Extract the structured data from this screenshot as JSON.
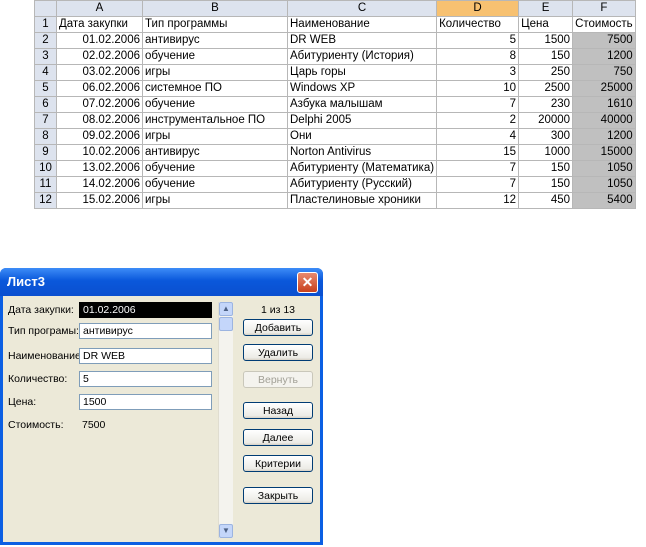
{
  "sheet": {
    "columns": [
      "A",
      "B",
      "C",
      "D",
      "E",
      "F"
    ],
    "rows": [
      {
        "n": "1",
        "a": "Дата закупки",
        "b": "Тип программы",
        "c": "Наименование",
        "d": "Количество",
        "e": "Цена",
        "f": "Стоимость"
      },
      {
        "n": "2",
        "a": "01.02.2006",
        "b": "антивирус",
        "c": "DR WEB",
        "d": "5",
        "e": "1500",
        "f": "7500"
      },
      {
        "n": "3",
        "a": "02.02.2006",
        "b": "обучение",
        "c": "Абитуриенту (История)",
        "d": "8",
        "e": "150",
        "f": "1200"
      },
      {
        "n": "4",
        "a": "03.02.2006",
        "b": "игры",
        "c": "Царь горы",
        "d": "3",
        "e": "250",
        "f": "750"
      },
      {
        "n": "5",
        "a": "06.02.2006",
        "b": "системное ПО",
        "c": "Windows XP",
        "d": "10",
        "e": "2500",
        "f": "25000"
      },
      {
        "n": "6",
        "a": "07.02.2006",
        "b": "обучение",
        "c": "Азбука малышам",
        "d": "7",
        "e": "230",
        "f": "1610"
      },
      {
        "n": "7",
        "a": "08.02.2006",
        "b": "инструментальное ПО",
        "c": "Delphi 2005",
        "d": "2",
        "e": "20000",
        "f": "40000"
      },
      {
        "n": "8",
        "a": "09.02.2006",
        "b": "игры",
        "c": "Они",
        "d": "4",
        "e": "300",
        "f": "1200"
      },
      {
        "n": "9",
        "a": "10.02.2006",
        "b": "антивирус",
        "c": "Norton Antivirus",
        "d": "15",
        "e": "1000",
        "f": "15000"
      },
      {
        "n": "10",
        "a": "13.02.2006",
        "b": "обучение",
        "c": "Абитуриенту (Математика)",
        "d": "7",
        "e": "150",
        "f": "1050"
      },
      {
        "n": "11",
        "a": "14.02.2006",
        "b": "обучение",
        "c": "Абитуриенту (Русский)",
        "d": "7",
        "e": "150",
        "f": "1050"
      },
      {
        "n": "12",
        "a": "15.02.2006",
        "b": "игры",
        "c": "Пластелиновые хроники",
        "d": "12",
        "e": "450",
        "f": "5400"
      }
    ]
  },
  "dialog": {
    "title": "Лист3",
    "close_glyph": "✕",
    "counter": "1 из 13",
    "fields": {
      "date_label": "Дата закупки:",
      "date_value": "01.02.2006",
      "type_label": "Тип програмы:",
      "type_value": "антивирус",
      "name_label": "Наименование:",
      "name_value": "DR WEB",
      "qty_label": "Количество:",
      "qty_value": "5",
      "price_label": "Цена:",
      "price_value": "1500",
      "cost_label": "Стоимость:",
      "cost_value": "7500"
    },
    "buttons": {
      "add": "Добавить",
      "delete": "Удалить",
      "restore": "Вернуть",
      "back": "Назад",
      "next": "Далее",
      "criteria": "Критерии",
      "close": "Закрыть"
    },
    "scroll_up": "▲",
    "scroll_down": "▼"
  }
}
